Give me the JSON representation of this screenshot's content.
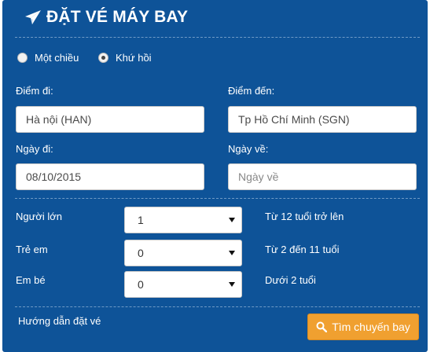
{
  "header": {
    "title": "ĐẶT VÉ MÁY BAY",
    "icon": "paper-plane-icon"
  },
  "trip_type": {
    "options": [
      {
        "label": "Một chiều",
        "checked": false
      },
      {
        "label": "Khứ hồi",
        "checked": true
      }
    ]
  },
  "from": {
    "label": "Điểm đi:",
    "value": "Hà nội (HAN)"
  },
  "to": {
    "label": "Điểm đến:",
    "value": "Tp Hồ Chí Minh (SGN)"
  },
  "depart": {
    "label": "Ngày đi:",
    "value": "08/10/2015"
  },
  "return": {
    "label": "Ngày về:",
    "placeholder": "Ngày về"
  },
  "passengers": {
    "adult": {
      "label": "Người lớn",
      "value": "1",
      "hint": "Từ 12 tuổi trở lên"
    },
    "child": {
      "label": "Trẻ em",
      "value": "0",
      "hint": "Từ 2 đến 11 tuổi"
    },
    "infant": {
      "label": "Em bé",
      "value": "0",
      "hint": "Dưới 2 tuổi"
    }
  },
  "footer": {
    "guide_link": "Hướng dẫn đặt vé",
    "search_button": "Tìm chuyến bay",
    "search_icon": "search-icon"
  },
  "colors": {
    "panel": "#0e5398",
    "button": "#f0a030"
  }
}
